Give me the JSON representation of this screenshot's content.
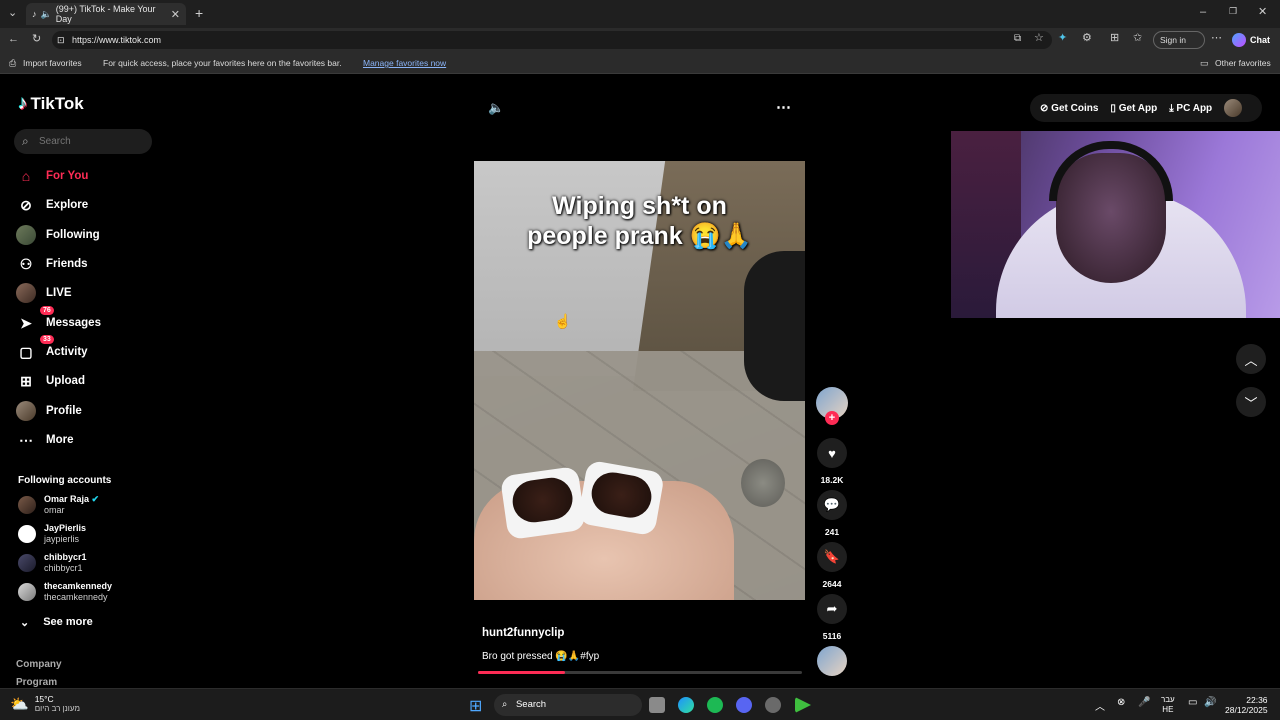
{
  "browser": {
    "tab_title": "(99+) TikTok - Make Your Day",
    "url": "https://www.tiktok.com",
    "signin_label": "Sign in",
    "chat_label": "Chat",
    "fav_import": "Import favorites",
    "fav_hint": "For quick access, place your favorites here on the favorites bar.",
    "fav_manage": "Manage favorites now",
    "fav_other": "Other favorites"
  },
  "sidebar": {
    "logo": "TikTok",
    "search_placeholder": "Search",
    "items": [
      {
        "label": "For You",
        "icon": "home-icon"
      },
      {
        "label": "Explore",
        "icon": "compass-icon"
      },
      {
        "label": "Following",
        "icon": "avatar-icon"
      },
      {
        "label": "Friends",
        "icon": "friends-icon"
      },
      {
        "label": "LIVE",
        "icon": "avatar-icon"
      },
      {
        "label": "Messages",
        "icon": "messages-icon",
        "badge": "76"
      },
      {
        "label": "Activity",
        "icon": "activity-icon",
        "badge": "33"
      },
      {
        "label": "Upload",
        "icon": "upload-icon"
      },
      {
        "label": "Profile",
        "icon": "avatar-icon"
      },
      {
        "label": "More",
        "icon": "more-icon"
      }
    ],
    "following_title": "Following accounts",
    "accounts": [
      {
        "name": "Omar Raja",
        "handle": "omar"
      },
      {
        "name": "JayPierlis",
        "handle": "jaypierlis"
      },
      {
        "name": "chibbycr1",
        "handle": "chibbycr1"
      },
      {
        "name": "thecamkennedy",
        "handle": "thecamkennedy"
      }
    ],
    "see_more": "See more",
    "footer": [
      "Company",
      "Program"
    ]
  },
  "header": {
    "get_coins": "Get Coins",
    "get_app": "Get App",
    "pc_app": "PC App"
  },
  "video": {
    "overlay_line1": "Wiping sh*t on",
    "overlay_line2": "people prank 😭🙏",
    "author": "hunt2funnyclip",
    "caption": "Bro got pressed 😭🙏#fyp",
    "progress": 0.27
  },
  "actions": {
    "likes": "18.2K",
    "comments": "241",
    "saves": "2644",
    "shares": "5116"
  },
  "taskbar": {
    "weather_temp": "15°C",
    "weather_desc": "מעונן רב היום",
    "search_label": "Search",
    "lang_top": "עבר",
    "lang_bottom": "HE",
    "time": "22:36",
    "date": "28/12/2025"
  },
  "colors": {
    "accent": "#fe2c55",
    "bg": "#000000"
  }
}
